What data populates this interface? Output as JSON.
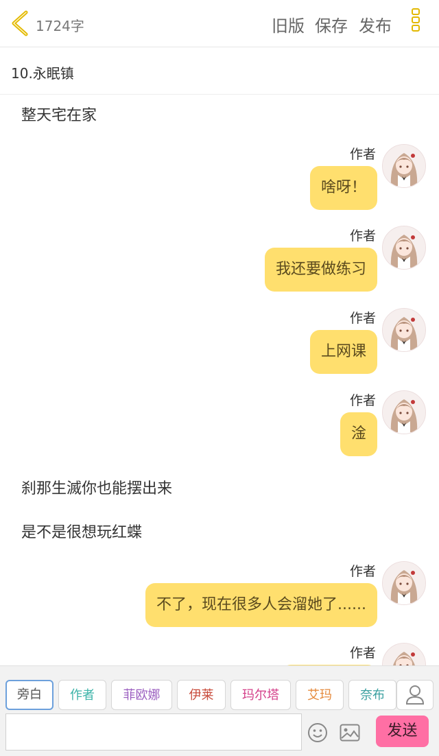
{
  "header": {
    "word_count": "1724字",
    "old_version": "旧版",
    "save": "保存",
    "publish": "发布"
  },
  "chapter_title": "10.永眠镇",
  "messages": [
    {
      "type": "narration",
      "text": "整天宅在家"
    },
    {
      "type": "author",
      "name": "作者",
      "text": "啥呀！"
    },
    {
      "type": "author",
      "name": "作者",
      "text": "我还要做练习"
    },
    {
      "type": "author",
      "name": "作者",
      "text": "上网课"
    },
    {
      "type": "author",
      "name": "作者",
      "text": "淦"
    },
    {
      "type": "narration",
      "text": "刹那生滅你也能摆出来"
    },
    {
      "type": "narration",
      "text": "是不是很想玩红蝶"
    },
    {
      "type": "author",
      "name": "作者",
      "text": "不了，现在很多人会溜她了......"
    },
    {
      "type": "author",
      "name": "作者",
      "text": ""
    }
  ],
  "roles": [
    {
      "label": "旁白",
      "color": "#555555"
    },
    {
      "label": "作者",
      "color": "#3bb3a8"
    },
    {
      "label": "菲欧娜",
      "color": "#9b5fc0"
    },
    {
      "label": "伊莱",
      "color": "#c84a3a"
    },
    {
      "label": "玛尔塔",
      "color": "#d4408a"
    },
    {
      "label": "艾玛",
      "color": "#e58a3c"
    },
    {
      "label": "奈布",
      "color": "#3aa0a0"
    }
  ],
  "input": {
    "value": "",
    "placeholder": ""
  },
  "send_label": "发送",
  "colors": {
    "bubble": "#ffdf6e",
    "accent": "#e2b800",
    "send": "#ff6fa4"
  }
}
